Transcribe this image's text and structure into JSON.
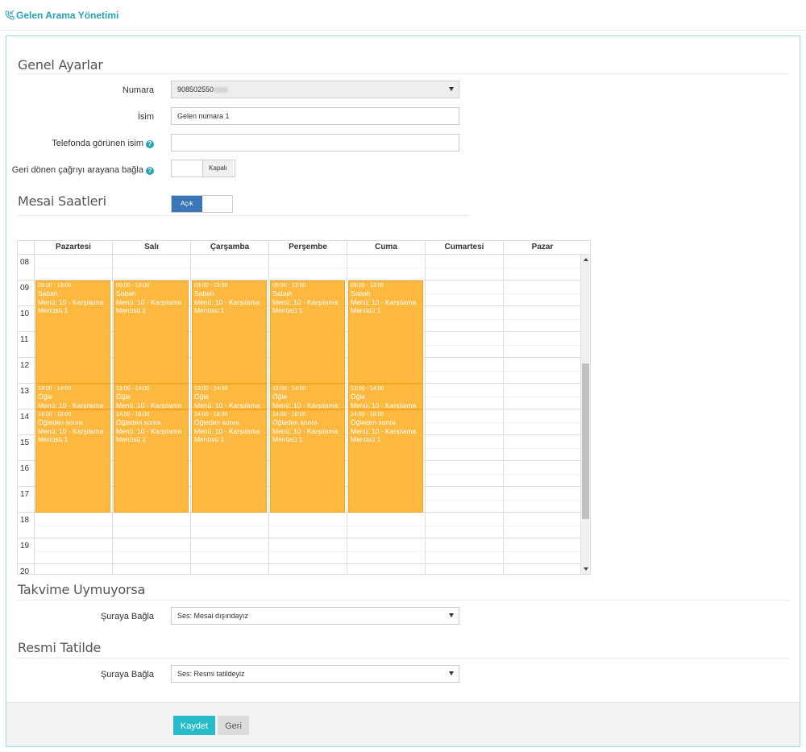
{
  "header": {
    "title": "Gelen Arama Yönetimi"
  },
  "general": {
    "title": "Genel Ayarlar",
    "number_label": "Numara",
    "number_value": "908502550",
    "name_label": "İsim",
    "name_value": "Gelen numara 1",
    "display_name_label": "Telefonda görünen isim",
    "display_name_value": "",
    "callback_label": "Geri dönen çağrıyı arayana bağla",
    "callback_state": "Kapalı"
  },
  "hours": {
    "title": "Mesai Saatleri",
    "toggle_state": "Açık",
    "days": [
      "Pazartesi",
      "Salı",
      "Çarşamba",
      "Perşembe",
      "Cuma",
      "Cumartesi",
      "Pazar"
    ],
    "hour_labels": [
      "08",
      "09",
      "10",
      "11",
      "12",
      "13",
      "14",
      "15",
      "16",
      "17",
      "18",
      "19",
      "20"
    ],
    "events": [
      {
        "time": "09:00 - 13:00",
        "name": "Sabah",
        "menu": "Menü: 10 - Karşılama Menüsü 1",
        "start": 9,
        "end": 13
      },
      {
        "time": "13:00 - 14:00",
        "name": "Öğle",
        "menu": "Menü: 10 - Karşılama Menüsü 1",
        "start": 13,
        "end": 14
      },
      {
        "time": "14:00 - 18:00",
        "name": "Öğleden sonra",
        "menu": "Menü: 10 - Karşılama Menüsü 1",
        "start": 14,
        "end": 18
      }
    ],
    "event_days": [
      0,
      1,
      2,
      3,
      4
    ]
  },
  "mismatch": {
    "title": "Takvime Uymuyorsa",
    "connect_label": "Şuraya Bağla",
    "connect_value": "Ses: Mesai dışındayız"
  },
  "holiday": {
    "title": "Resmi Tatilde",
    "connect_label": "Şuraya Bağla",
    "connect_value": "Ses: Resmi tatildeyiz"
  },
  "actions": {
    "save": "Kaydet",
    "back": "Geri"
  },
  "colors": {
    "accent": "#27a4b3",
    "event": "#fdb93f",
    "toggle_on": "#3a76b8"
  }
}
